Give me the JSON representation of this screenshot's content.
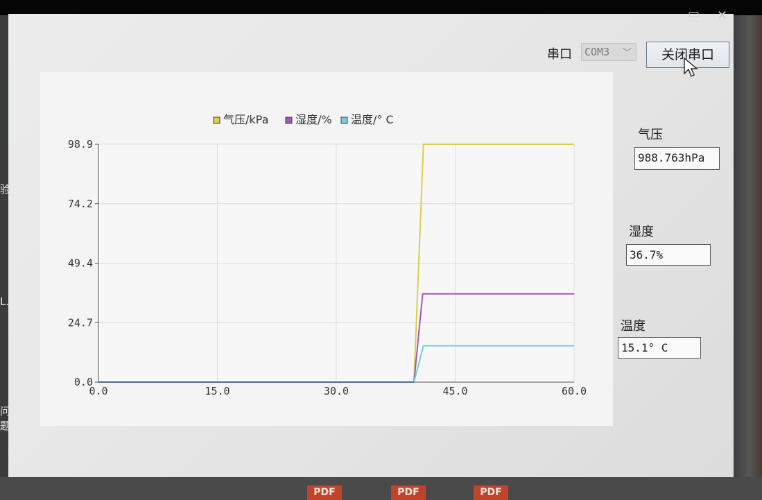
{
  "serial": {
    "label": "串口",
    "selected_port": "COM3",
    "close_button_label": "关闭串口"
  },
  "readings": {
    "pressure": {
      "label": "气压",
      "value": "988.763hPa"
    },
    "humidity": {
      "label": "湿度",
      "value": "36.7%"
    },
    "temperature": {
      "label": "温度",
      "value": "15.1° C"
    }
  },
  "background": {
    "left_labels": [
      "验",
      "L..",
      "问题"
    ],
    "pdf_labels": [
      "PDF",
      "PDF",
      "PDF"
    ]
  },
  "chart_data": {
    "type": "line",
    "title": "",
    "xlabel": "",
    "ylabel": "",
    "xlim": [
      0,
      60
    ],
    "ylim": [
      0,
      98.9
    ],
    "x_ticks": [
      "0.0",
      "15.0",
      "30.0",
      "45.0",
      "60.0"
    ],
    "y_ticks": [
      "0.0",
      "24.7",
      "49.4",
      "74.2",
      "98.9"
    ],
    "grid": true,
    "legend_position": "top-center",
    "series": [
      {
        "name": "气压/kPa",
        "color": "#d8cf4a",
        "x": [
          0,
          39.8,
          41,
          41,
          60
        ],
        "y": [
          0,
          0,
          98.9,
          98.9,
          98.9
        ]
      },
      {
        "name": "湿度/%",
        "color": "#a25ab8",
        "x": [
          0,
          39.8,
          40.9,
          60
        ],
        "y": [
          0,
          0,
          36.7,
          36.7
        ]
      },
      {
        "name": "温度/° C",
        "color": "#78cfd6",
        "x": [
          0,
          39.8,
          41,
          60
        ],
        "y": [
          0,
          0,
          15.1,
          15.1
        ]
      }
    ]
  }
}
